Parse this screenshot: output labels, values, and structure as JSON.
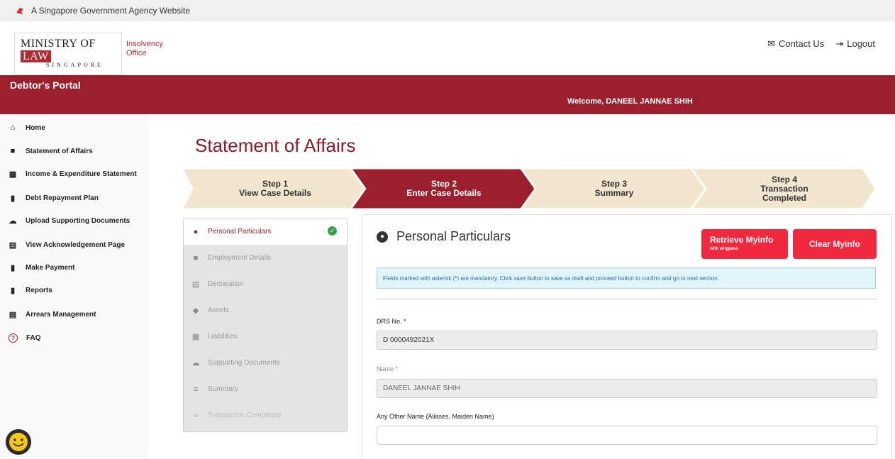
{
  "gov_bar": {
    "text": "A Singapore Government Agency Website"
  },
  "header": {
    "logo_main": "MINISTRY OF",
    "logo_law": "LAW",
    "logo_country": "SINGAPORE",
    "logo_sub_line1": "Insolvency",
    "logo_sub_line2": "Office",
    "contact_label": "Contact Us",
    "logout_label": "Logout"
  },
  "banner": {
    "portal": "Debtor's Portal",
    "welcome": "Welcome, DANEEL JANNAE SHIH"
  },
  "sidebar": {
    "items": [
      {
        "label": "Home",
        "icon": "home-icon"
      },
      {
        "label": "Statement of Affairs",
        "icon": "folder-icon"
      },
      {
        "label": "Income & Expenditure Statement",
        "icon": "calculator-icon"
      },
      {
        "label": "Debt Repayment Plan",
        "icon": "money-icon"
      },
      {
        "label": "Upload Supporting Documents",
        "icon": "cloud-upload-icon"
      },
      {
        "label": "View Acknowledgement Page",
        "icon": "document-icon"
      },
      {
        "label": "Make Payment",
        "icon": "payment-icon"
      },
      {
        "label": "Reports",
        "icon": "report-icon"
      },
      {
        "label": "Arrears Management",
        "icon": "arrears-icon"
      },
      {
        "label": "FAQ",
        "icon": "question-icon"
      }
    ]
  },
  "page": {
    "title": "Statement of Affairs"
  },
  "steps": [
    {
      "line1": "Step 1",
      "line2": "View Case Details",
      "line3": "",
      "active": false
    },
    {
      "line1": "Step 2",
      "line2": "Enter Case Details",
      "line3": "",
      "active": true
    },
    {
      "line1": "Step 3",
      "line2": "Summary",
      "line3": "",
      "active": false
    },
    {
      "line1": "Step 4",
      "line2": "Transaction",
      "line3": "Completed",
      "active": false
    }
  ],
  "sections": [
    {
      "label": "Personal Particulars",
      "icon": "user-circle-icon",
      "active": true,
      "done": true
    },
    {
      "label": "Employment Details",
      "icon": "briefcase-icon"
    },
    {
      "label": "Declaration",
      "icon": "file-icon"
    },
    {
      "label": "Assets",
      "icon": "layers-icon"
    },
    {
      "label": "Liabilities",
      "icon": "table-icon"
    },
    {
      "label": "Supporting Documents",
      "icon": "cloud-upload-icon"
    },
    {
      "label": "Summary",
      "icon": "list-icon"
    },
    {
      "label": "Transaction Completed",
      "icon": "list-check-icon"
    }
  ],
  "form": {
    "heading": "Personal Particulars",
    "retrieve_myinfo": "Retrieve Myinfo",
    "retrieve_sub": "with singpass",
    "clear_myinfo": "Clear Myinfo",
    "info_text": "Fields marked with asterisk (*) are mandatory. Click save button to save as draft and proceed button to confirm and go to next section.",
    "drs_label": "DRS No. *",
    "drs_value": "D 0000492021X",
    "name_label": "Name *",
    "name_value": "DANEEL JANNAE SHIH",
    "other_name_label": "Any Other Name (Aliases, Maiden Name)",
    "other_name_value": ""
  },
  "colors": {
    "brand": "#9c1f2e",
    "accent_button": "#f0293e",
    "step_inactive": "#f3e6cf",
    "success": "#3aa14a"
  }
}
